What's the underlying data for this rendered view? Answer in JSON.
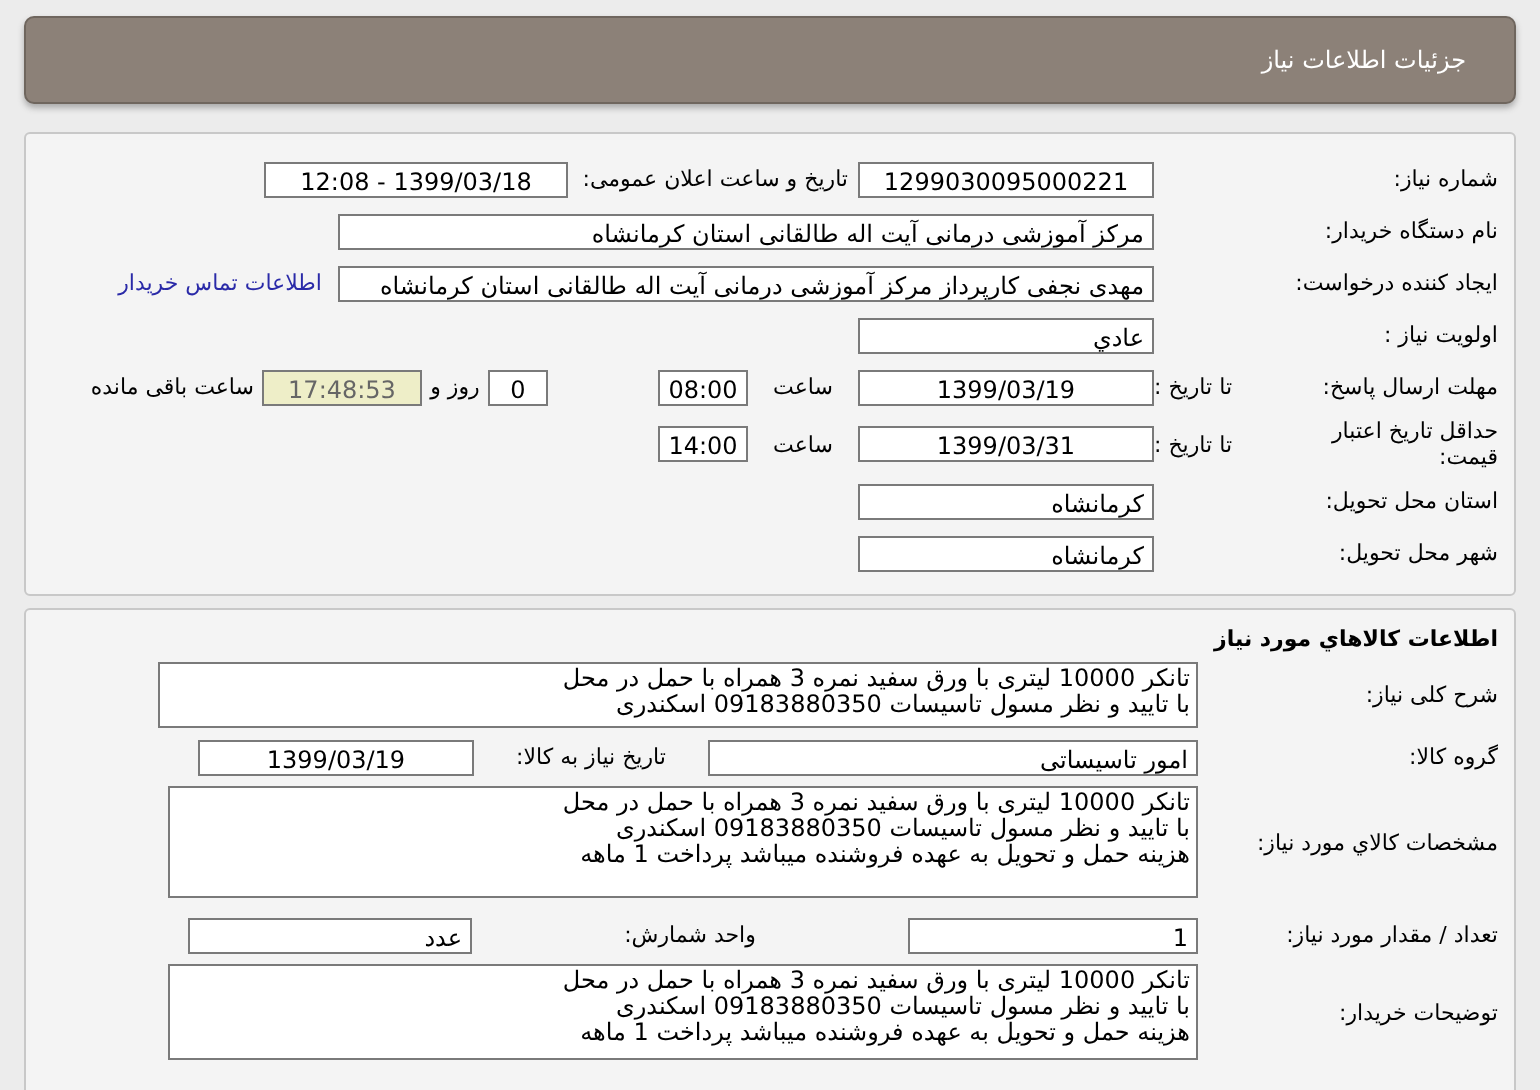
{
  "header": {
    "title": "جزئیات اطلاعات نیاز"
  },
  "need_info": {
    "need_number": {
      "label": "شماره نیاز:",
      "value": "1299030095000221"
    },
    "announce": {
      "label": "تاریخ و ساعت اعلان عمومی:",
      "value": "1399/03/18 - 12:08"
    },
    "buyer": {
      "label": "نام دستگاه خریدار:",
      "value": "مرکز آموزشی درمانی آیت اله طالقانی استان کرمانشاه"
    },
    "creator": {
      "label": "ایجاد کننده درخواست:",
      "value": "مهدی نجفی کارپرداز مرکز آموزشی درمانی آیت اله طالقانی استان کرمانشاه"
    },
    "contact_link": "اطلاعات تماس خریدار",
    "priority": {
      "label": "اولویت نیاز :",
      "value": "عادي"
    },
    "deadline": {
      "label": "مهلت ارسال پاسخ:",
      "to_date_label": "تا تاریخ :",
      "date": "1399/03/19",
      "time_label": "ساعت",
      "time": "08:00",
      "days": "0",
      "days_label": "روز و",
      "remaining": "17:48:53",
      "remaining_label": "ساعت باقی مانده"
    },
    "validity": {
      "label": "حداقل تاریخ اعتبار قیمت:",
      "to_date_label": "تا تاریخ :",
      "date": "1399/03/31",
      "time_label": "ساعت",
      "time": "14:00"
    },
    "province": {
      "label": "استان محل تحویل:",
      "value": "کرمانشاه"
    },
    "city": {
      "label": "شهر محل تحویل:",
      "value": "کرمانشاه"
    }
  },
  "goods_info": {
    "title": "اطلاعات کالاهاي مورد نياز",
    "summary": {
      "label": "شرح کلی نیاز:",
      "lines": [
        "تانکر 10000 لیتری با ورق سفید نمره 3 همراه با حمل در محل",
        "با تایید و نظر مسول تاسیسات 09183880350 اسکندری"
      ]
    },
    "group": {
      "label": "گروه کالا:",
      "value": "امور تاسیساتی"
    },
    "need_date": {
      "label": "تاریخ نیاز به کالا:",
      "value": "1399/03/19"
    },
    "specs": {
      "label": "مشخصات کالاي مورد نياز:",
      "lines": [
        "تانکر 10000 لیتری با ورق سفید نمره 3 همراه با حمل در محل",
        "با تایید و نظر مسول تاسیسات 09183880350 اسکندری",
        "هزینه حمل و تحویل به عهده فروشنده میباشد پرداخت 1 ماهه"
      ]
    },
    "quantity": {
      "label": "تعداد / مقدار مورد نیاز:",
      "value": "1"
    },
    "unit": {
      "label": "واحد شمارش:",
      "value": "عدد"
    },
    "buyer_notes": {
      "label": "توضیحات خریدار:",
      "lines": [
        "تانکر 10000 لیتری با ورق سفید نمره 3 همراه با حمل در محل",
        "با تایید و نظر مسول تاسیسات 09183880350 اسکندری",
        "هزینه حمل و تحویل به عهده فروشنده میباشد پرداخت 1 ماهه"
      ]
    }
  }
}
